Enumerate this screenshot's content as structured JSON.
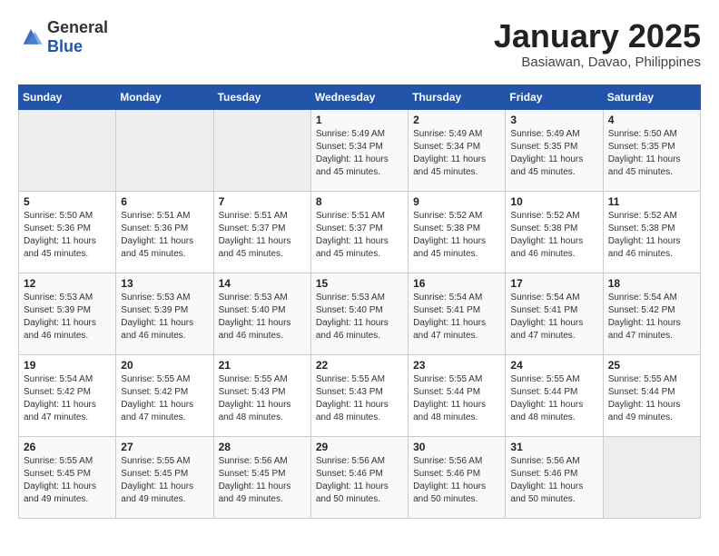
{
  "header": {
    "logo_general": "General",
    "logo_blue": "Blue",
    "month": "January 2025",
    "location": "Basiawan, Davao, Philippines"
  },
  "days_of_week": [
    "Sunday",
    "Monday",
    "Tuesday",
    "Wednesday",
    "Thursday",
    "Friday",
    "Saturday"
  ],
  "weeks": [
    [
      {
        "day": "",
        "info": ""
      },
      {
        "day": "",
        "info": ""
      },
      {
        "day": "",
        "info": ""
      },
      {
        "day": "1",
        "info": "Sunrise: 5:49 AM\nSunset: 5:34 PM\nDaylight: 11 hours\nand 45 minutes."
      },
      {
        "day": "2",
        "info": "Sunrise: 5:49 AM\nSunset: 5:34 PM\nDaylight: 11 hours\nand 45 minutes."
      },
      {
        "day": "3",
        "info": "Sunrise: 5:49 AM\nSunset: 5:35 PM\nDaylight: 11 hours\nand 45 minutes."
      },
      {
        "day": "4",
        "info": "Sunrise: 5:50 AM\nSunset: 5:35 PM\nDaylight: 11 hours\nand 45 minutes."
      }
    ],
    [
      {
        "day": "5",
        "info": "Sunrise: 5:50 AM\nSunset: 5:36 PM\nDaylight: 11 hours\nand 45 minutes."
      },
      {
        "day": "6",
        "info": "Sunrise: 5:51 AM\nSunset: 5:36 PM\nDaylight: 11 hours\nand 45 minutes."
      },
      {
        "day": "7",
        "info": "Sunrise: 5:51 AM\nSunset: 5:37 PM\nDaylight: 11 hours\nand 45 minutes."
      },
      {
        "day": "8",
        "info": "Sunrise: 5:51 AM\nSunset: 5:37 PM\nDaylight: 11 hours\nand 45 minutes."
      },
      {
        "day": "9",
        "info": "Sunrise: 5:52 AM\nSunset: 5:38 PM\nDaylight: 11 hours\nand 45 minutes."
      },
      {
        "day": "10",
        "info": "Sunrise: 5:52 AM\nSunset: 5:38 PM\nDaylight: 11 hours\nand 46 minutes."
      },
      {
        "day": "11",
        "info": "Sunrise: 5:52 AM\nSunset: 5:38 PM\nDaylight: 11 hours\nand 46 minutes."
      }
    ],
    [
      {
        "day": "12",
        "info": "Sunrise: 5:53 AM\nSunset: 5:39 PM\nDaylight: 11 hours\nand 46 minutes."
      },
      {
        "day": "13",
        "info": "Sunrise: 5:53 AM\nSunset: 5:39 PM\nDaylight: 11 hours\nand 46 minutes."
      },
      {
        "day": "14",
        "info": "Sunrise: 5:53 AM\nSunset: 5:40 PM\nDaylight: 11 hours\nand 46 minutes."
      },
      {
        "day": "15",
        "info": "Sunrise: 5:53 AM\nSunset: 5:40 PM\nDaylight: 11 hours\nand 46 minutes."
      },
      {
        "day": "16",
        "info": "Sunrise: 5:54 AM\nSunset: 5:41 PM\nDaylight: 11 hours\nand 47 minutes."
      },
      {
        "day": "17",
        "info": "Sunrise: 5:54 AM\nSunset: 5:41 PM\nDaylight: 11 hours\nand 47 minutes."
      },
      {
        "day": "18",
        "info": "Sunrise: 5:54 AM\nSunset: 5:42 PM\nDaylight: 11 hours\nand 47 minutes."
      }
    ],
    [
      {
        "day": "19",
        "info": "Sunrise: 5:54 AM\nSunset: 5:42 PM\nDaylight: 11 hours\nand 47 minutes."
      },
      {
        "day": "20",
        "info": "Sunrise: 5:55 AM\nSunset: 5:42 PM\nDaylight: 11 hours\nand 47 minutes."
      },
      {
        "day": "21",
        "info": "Sunrise: 5:55 AM\nSunset: 5:43 PM\nDaylight: 11 hours\nand 48 minutes."
      },
      {
        "day": "22",
        "info": "Sunrise: 5:55 AM\nSunset: 5:43 PM\nDaylight: 11 hours\nand 48 minutes."
      },
      {
        "day": "23",
        "info": "Sunrise: 5:55 AM\nSunset: 5:44 PM\nDaylight: 11 hours\nand 48 minutes."
      },
      {
        "day": "24",
        "info": "Sunrise: 5:55 AM\nSunset: 5:44 PM\nDaylight: 11 hours\nand 48 minutes."
      },
      {
        "day": "25",
        "info": "Sunrise: 5:55 AM\nSunset: 5:44 PM\nDaylight: 11 hours\nand 49 minutes."
      }
    ],
    [
      {
        "day": "26",
        "info": "Sunrise: 5:55 AM\nSunset: 5:45 PM\nDaylight: 11 hours\nand 49 minutes."
      },
      {
        "day": "27",
        "info": "Sunrise: 5:55 AM\nSunset: 5:45 PM\nDaylight: 11 hours\nand 49 minutes."
      },
      {
        "day": "28",
        "info": "Sunrise: 5:56 AM\nSunset: 5:45 PM\nDaylight: 11 hours\nand 49 minutes."
      },
      {
        "day": "29",
        "info": "Sunrise: 5:56 AM\nSunset: 5:46 PM\nDaylight: 11 hours\nand 50 minutes."
      },
      {
        "day": "30",
        "info": "Sunrise: 5:56 AM\nSunset: 5:46 PM\nDaylight: 11 hours\nand 50 minutes."
      },
      {
        "day": "31",
        "info": "Sunrise: 5:56 AM\nSunset: 5:46 PM\nDaylight: 11 hours\nand 50 minutes."
      },
      {
        "day": "",
        "info": ""
      }
    ]
  ]
}
